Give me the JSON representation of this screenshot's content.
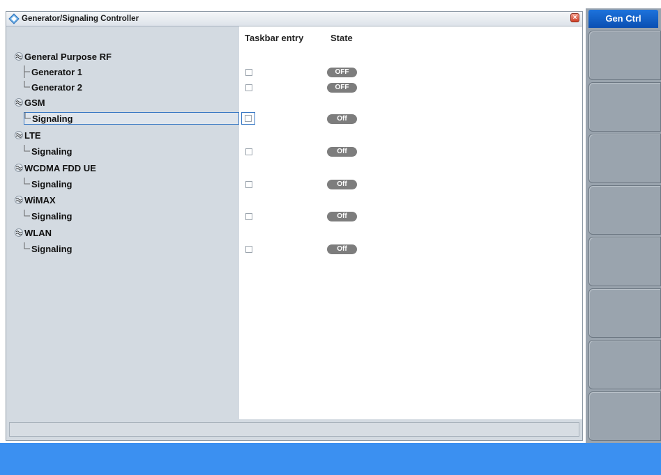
{
  "window": {
    "title": "Generator/Signaling Controller",
    "close_label": "×"
  },
  "columns": {
    "taskbar": "Taskbar entry",
    "state": "State"
  },
  "tree": {
    "gprf": {
      "label": "General Purpose RF",
      "items": [
        {
          "label": "Generator 1",
          "state": "OFF"
        },
        {
          "label": "Generator 2",
          "state": "OFF"
        }
      ]
    },
    "gsm": {
      "label": "GSM",
      "items": [
        {
          "label": "Signaling",
          "state": "Off"
        }
      ]
    },
    "lte": {
      "label": "LTE",
      "items": [
        {
          "label": "Signaling",
          "state": "Off"
        }
      ]
    },
    "wcdma": {
      "label": "WCDMA FDD UE",
      "items": [
        {
          "label": "Signaling",
          "state": "Off"
        }
      ]
    },
    "wimax": {
      "label": "WiMAX",
      "items": [
        {
          "label": "Signaling",
          "state": "Off"
        }
      ]
    },
    "wlan": {
      "label": "WLAN",
      "items": [
        {
          "label": "Signaling",
          "state": "Off"
        }
      ]
    }
  },
  "softkeys": {
    "title": "Gen Ctrl"
  },
  "colors": {
    "accent": "#0a4fb2",
    "bottom_bar": "#3b90f1",
    "state_pill": "#7d7d7d"
  },
  "icons": {
    "title": "rs-diamond-icon",
    "category": "wave-icon",
    "close": "close-icon"
  }
}
